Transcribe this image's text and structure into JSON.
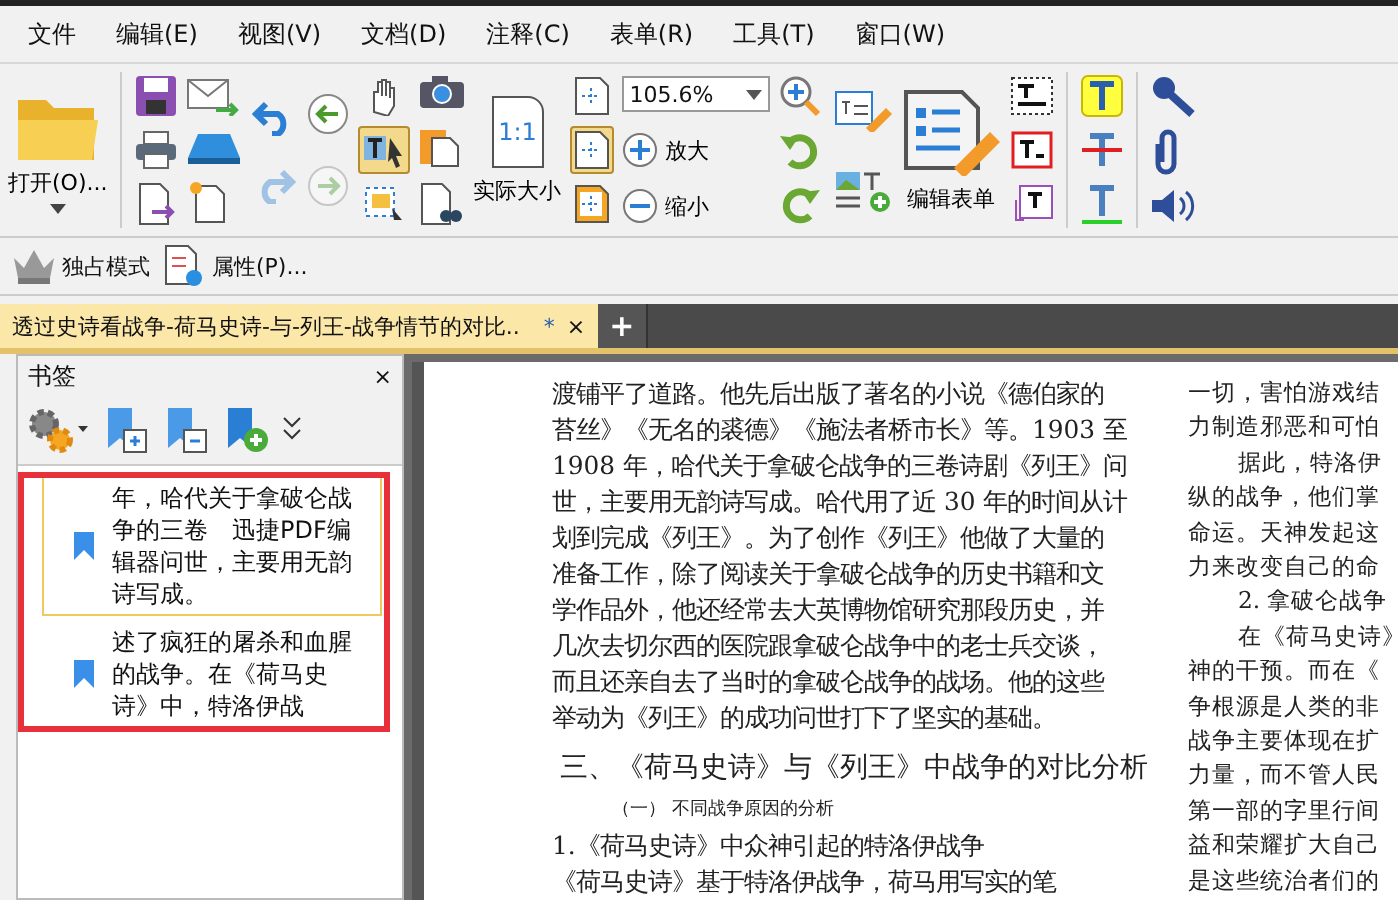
{
  "menu": [
    "文件",
    "编辑(E)",
    "视图(V)",
    "文档(D)",
    "注释(C)",
    "表单(R)",
    "工具(T)",
    "窗口(W)"
  ],
  "toolbar": {
    "open_label": "打开(O)...",
    "history": [
      {
        "kind": "undo",
        "disabled": false
      },
      {
        "kind": "redo",
        "disabled": true
      }
    ],
    "nav": [
      {
        "kind": "back",
        "disabled": false
      },
      {
        "kind": "forward",
        "disabled": true
      }
    ],
    "tools": [
      {
        "kind": "hand",
        "selected": false
      },
      {
        "kind": "select-text",
        "selected": true
      },
      {
        "kind": "select-annotation",
        "selected": false
      }
    ],
    "fit_tools": [
      {
        "kind": "fit-width",
        "selected": false
      },
      {
        "kind": "fit-page",
        "selected": true
      },
      {
        "kind": "fit-visible",
        "selected": false
      }
    ],
    "actual_size": "实际大小",
    "actual_size_icon": "1:1",
    "zoom": "105.6%",
    "zoom_in": "放大",
    "zoom_out": "缩小",
    "edit_form": "编辑表单"
  },
  "toolbar2": [
    {
      "kind": "crown",
      "label": "独占模式"
    },
    {
      "kind": "properties",
      "label": "属性(P)..."
    }
  ],
  "tab": {
    "title": "透过史诗看战争-荷马史诗-与-列王-战争情节的对比..",
    "modified": "*",
    "close": "×",
    "add": "+"
  },
  "sidebar": {
    "title": "书签",
    "close": "×",
    "bookmarks": [
      {
        "text": "年，哈代关于拿破仑战争的三卷　迅捷PDF编辑器问世，主要用无韵诗写成。",
        "selected": true
      },
      {
        "text": "述了疯狂的屠杀和血腥的战争。在《荷马史诗》中，特洛伊战",
        "selected": false
      }
    ]
  },
  "document": {
    "left": [
      {
        "kind": "p",
        "text": "渡铺平了道路。他先后出版了著名的小说《德伯家的"
      },
      {
        "kind": "p",
        "text": "苔丝》《无名的裘德》《施法者桥市长》等。1903 至"
      },
      {
        "kind": "p",
        "text": "1908 年，哈代关于拿破仑战争的三卷诗剧《列王》问"
      },
      {
        "kind": "p",
        "text": "世，主要用无韵诗写成。哈代用了近 30 年的时间从计"
      },
      {
        "kind": "p",
        "text": "划到完成《列王》。为了创作《列王》他做了大量的"
      },
      {
        "kind": "p",
        "text": "准备工作，除了阅读关于拿破仑战争的历史书籍和文"
      },
      {
        "kind": "p",
        "text": "学作品外，他还经常去大英博物馆研究那段历史，并"
      },
      {
        "kind": "p",
        "text": "几次去切尔西的医院跟拿破仑战争中的老士兵交谈，"
      },
      {
        "kind": "p",
        "text": "而且还亲自去了当时的拿破仑战争的战场。他的这些"
      },
      {
        "kind": "p",
        "text": "举动为《列王》的成功问世打下了坚实的基础。"
      },
      {
        "kind": "heading",
        "text": "三、《荷马史诗》与《列王》中战争的对比分析"
      },
      {
        "kind": "subheading",
        "text": "（一） 不同战争原因的分析"
      },
      {
        "kind": "p",
        "text": "1.《荷马史诗》中众神引起的特洛伊战争"
      },
      {
        "kind": "p",
        "text": "《荷马史诗》基于特洛伊战争，荷马用写实的笔"
      }
    ],
    "right": [
      {
        "kind": "p",
        "text": "一切，害怕游戏结"
      },
      {
        "kind": "p",
        "text": "力制造邪恶和可怕"
      },
      {
        "kind": "indent",
        "text": "据此，特洛伊"
      },
      {
        "kind": "p",
        "text": "纵的战争，他们掌"
      },
      {
        "kind": "p",
        "text": "命运。天神发起这"
      },
      {
        "kind": "p",
        "text": "力来改变自己的命"
      },
      {
        "kind": "indent",
        "text": "2. 拿破仑战争"
      },
      {
        "kind": "indent",
        "text": "在《荷马史诗》"
      },
      {
        "kind": "p",
        "text": "神的干预。而在《"
      },
      {
        "kind": "p",
        "text": "争根源是人类的非"
      },
      {
        "kind": "p",
        "text": "战争主要体现在扩"
      },
      {
        "kind": "p",
        "text": "力量，而不管人民"
      },
      {
        "kind": "p",
        "text": "第一部的字里行间"
      },
      {
        "kind": "p",
        "text": "益和荣耀扩大自己"
      },
      {
        "kind": "p",
        "text": "是这些统治者们的"
      }
    ]
  }
}
